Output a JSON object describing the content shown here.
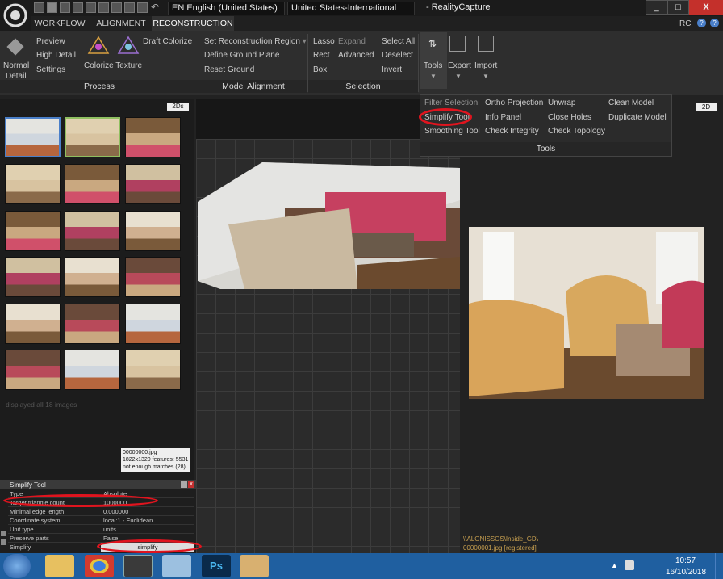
{
  "title_bar": {
    "app_title": "RealityCapture",
    "lang_en": "EN English (United States)",
    "lang_intl": "United States-International",
    "minimize": "_",
    "maximize": "□",
    "close": "X",
    "rc_label": "RC"
  },
  "tabs": [
    "WORKFLOW",
    "ALIGNMENT",
    "RECONSTRUCTION"
  ],
  "ribbon": {
    "process": {
      "normal": "Normal",
      "detail": "Detail",
      "preview": "Preview",
      "high_detail": "High Detail",
      "settings": "Settings",
      "draft_colorize": "Draft Colorize",
      "colorize_texture": "Colorize Texture",
      "group": "Process"
    },
    "model_alignment": {
      "set_region": "Set Reconstruction Region",
      "define_ground": "Define Ground Plane",
      "reset_ground": "Reset Ground",
      "group": "Model Alignment"
    },
    "selection": {
      "lasso": "Lasso",
      "rect": "Rect",
      "box": "Box",
      "expand": "Expand",
      "advanced": "Advanced",
      "select_all": "Select All",
      "deselect": "Deselect",
      "invert": "Invert",
      "group": "Selection"
    },
    "tools": "Tools",
    "export": "Export",
    "import": "Import"
  },
  "tools_dropdown": {
    "filter_selection": "Filter Selection",
    "simplify_tool": "Simplify Tool",
    "smoothing_tool": "Smoothing Tool",
    "ortho_projection": "Ortho Projection",
    "info_panel": "Info Panel",
    "check_integrity": "Check Integrity",
    "unwrap": "Unwrap",
    "close_holes": "Close Holes",
    "check_topology": "Check Topology",
    "clean_model": "Clean Model",
    "duplicate_model": "Duplicate Model",
    "footer": "Tools"
  },
  "left_panel": {
    "badge": "2Ds",
    "status": "displayed all 18 images",
    "tooltip": {
      "file": "00000000.jpg",
      "size": "1822x1320",
      "features": "features: 5531",
      "note": "not enough matches (28)"
    }
  },
  "view2d": {
    "badge": "2D",
    "path": "\\\\ALONISSOS\\Inside_GD\\",
    "file": "00000001.jpg [registered]"
  },
  "simplify_panel": {
    "title": "Simplify Tool",
    "rows": [
      {
        "k": "Type",
        "v": "Absolute"
      },
      {
        "k": "Target triangle count",
        "v": "1000000"
      },
      {
        "k": "Minimal edge length",
        "v": "0.000000"
      },
      {
        "k": "Coordinate system",
        "v": "local:1 - Euclidean"
      },
      {
        "k": "Unit type",
        "v": "units"
      },
      {
        "k": "Preserve parts",
        "v": "False"
      },
      {
        "k": "Simplify",
        "v": "simplify"
      }
    ]
  },
  "taskbar": {
    "time": "10:57",
    "date": "16/10/2018"
  },
  "colors": {
    "accent": "#4a7fc9",
    "highlight": "#e0141e",
    "taskbar": "#1f5fa0"
  }
}
